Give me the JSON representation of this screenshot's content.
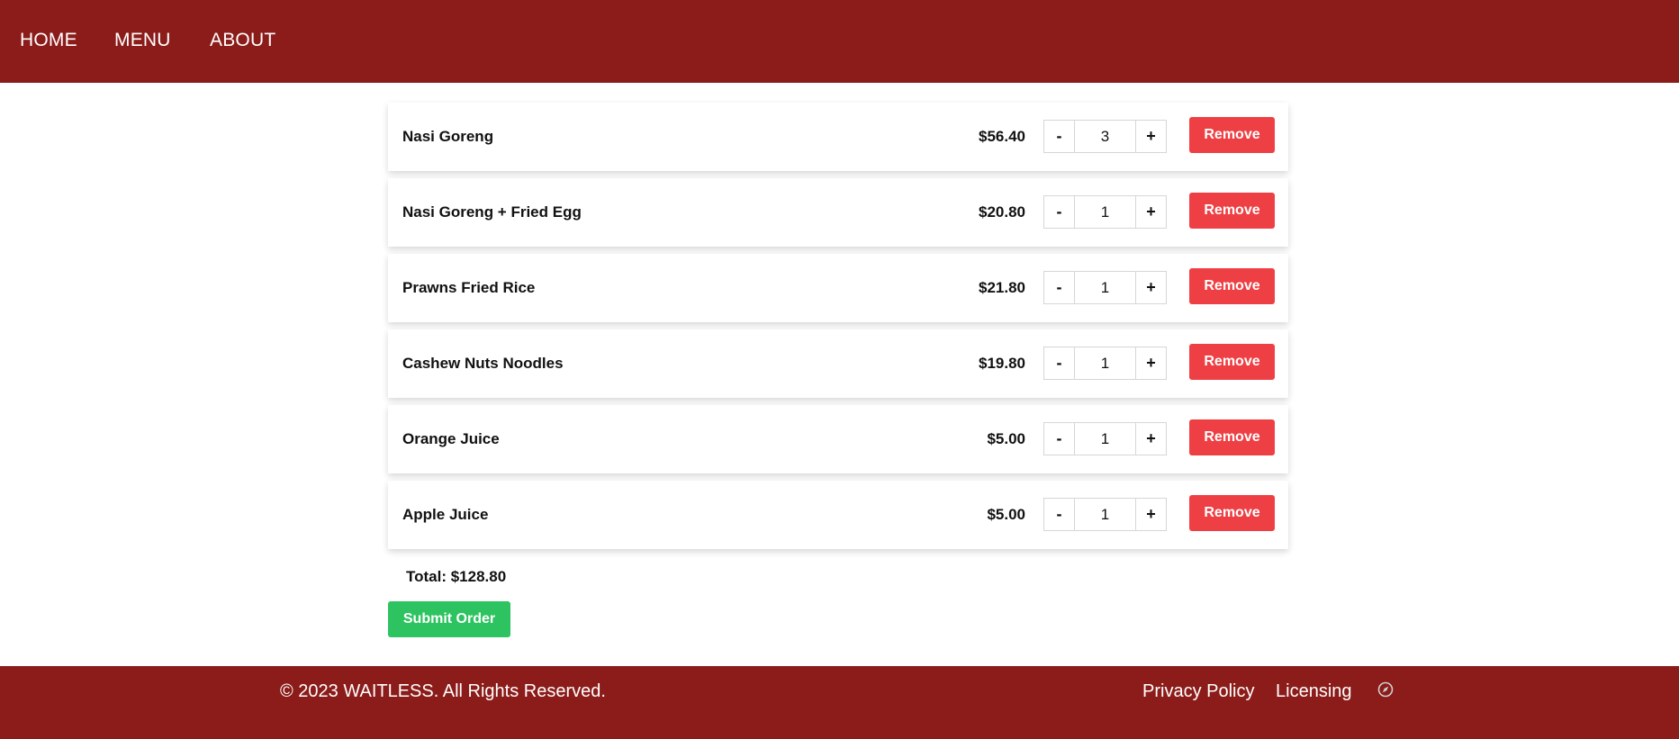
{
  "nav": {
    "items": [
      {
        "label": "HOME"
      },
      {
        "label": "MENU"
      },
      {
        "label": "ABOUT"
      }
    ]
  },
  "cart": {
    "items": [
      {
        "name": "Nasi Goreng",
        "price": "$56.40",
        "quantity": "3",
        "minus": "-",
        "plus": "+",
        "remove": "Remove"
      },
      {
        "name": "Nasi Goreng + Fried Egg",
        "price": "$20.80",
        "quantity": "1",
        "minus": "-",
        "plus": "+",
        "remove": "Remove"
      },
      {
        "name": "Prawns Fried Rice",
        "price": "$21.80",
        "quantity": "1",
        "minus": "-",
        "plus": "+",
        "remove": "Remove"
      },
      {
        "name": "Cashew Nuts Noodles",
        "price": "$19.80",
        "quantity": "1",
        "minus": "-",
        "plus": "+",
        "remove": "Remove"
      },
      {
        "name": "Orange Juice",
        "price": "$5.00",
        "quantity": "1",
        "minus": "-",
        "plus": "+",
        "remove": "Remove"
      },
      {
        "name": "Apple Juice",
        "price": "$5.00",
        "quantity": "1",
        "minus": "-",
        "plus": "+",
        "remove": "Remove"
      }
    ],
    "total": "Total: $128.80",
    "submit_label": "Submit Order"
  },
  "footer": {
    "copyright": "© 2023 WAITLESS. All Rights Reserved.",
    "links": [
      {
        "label": "Privacy Policy"
      },
      {
        "label": "Licensing"
      }
    ],
    "icon": "compass-icon"
  },
  "colors": {
    "brand": "#8b1c1a",
    "remove": "#ee4044",
    "submit": "#2ec361"
  }
}
